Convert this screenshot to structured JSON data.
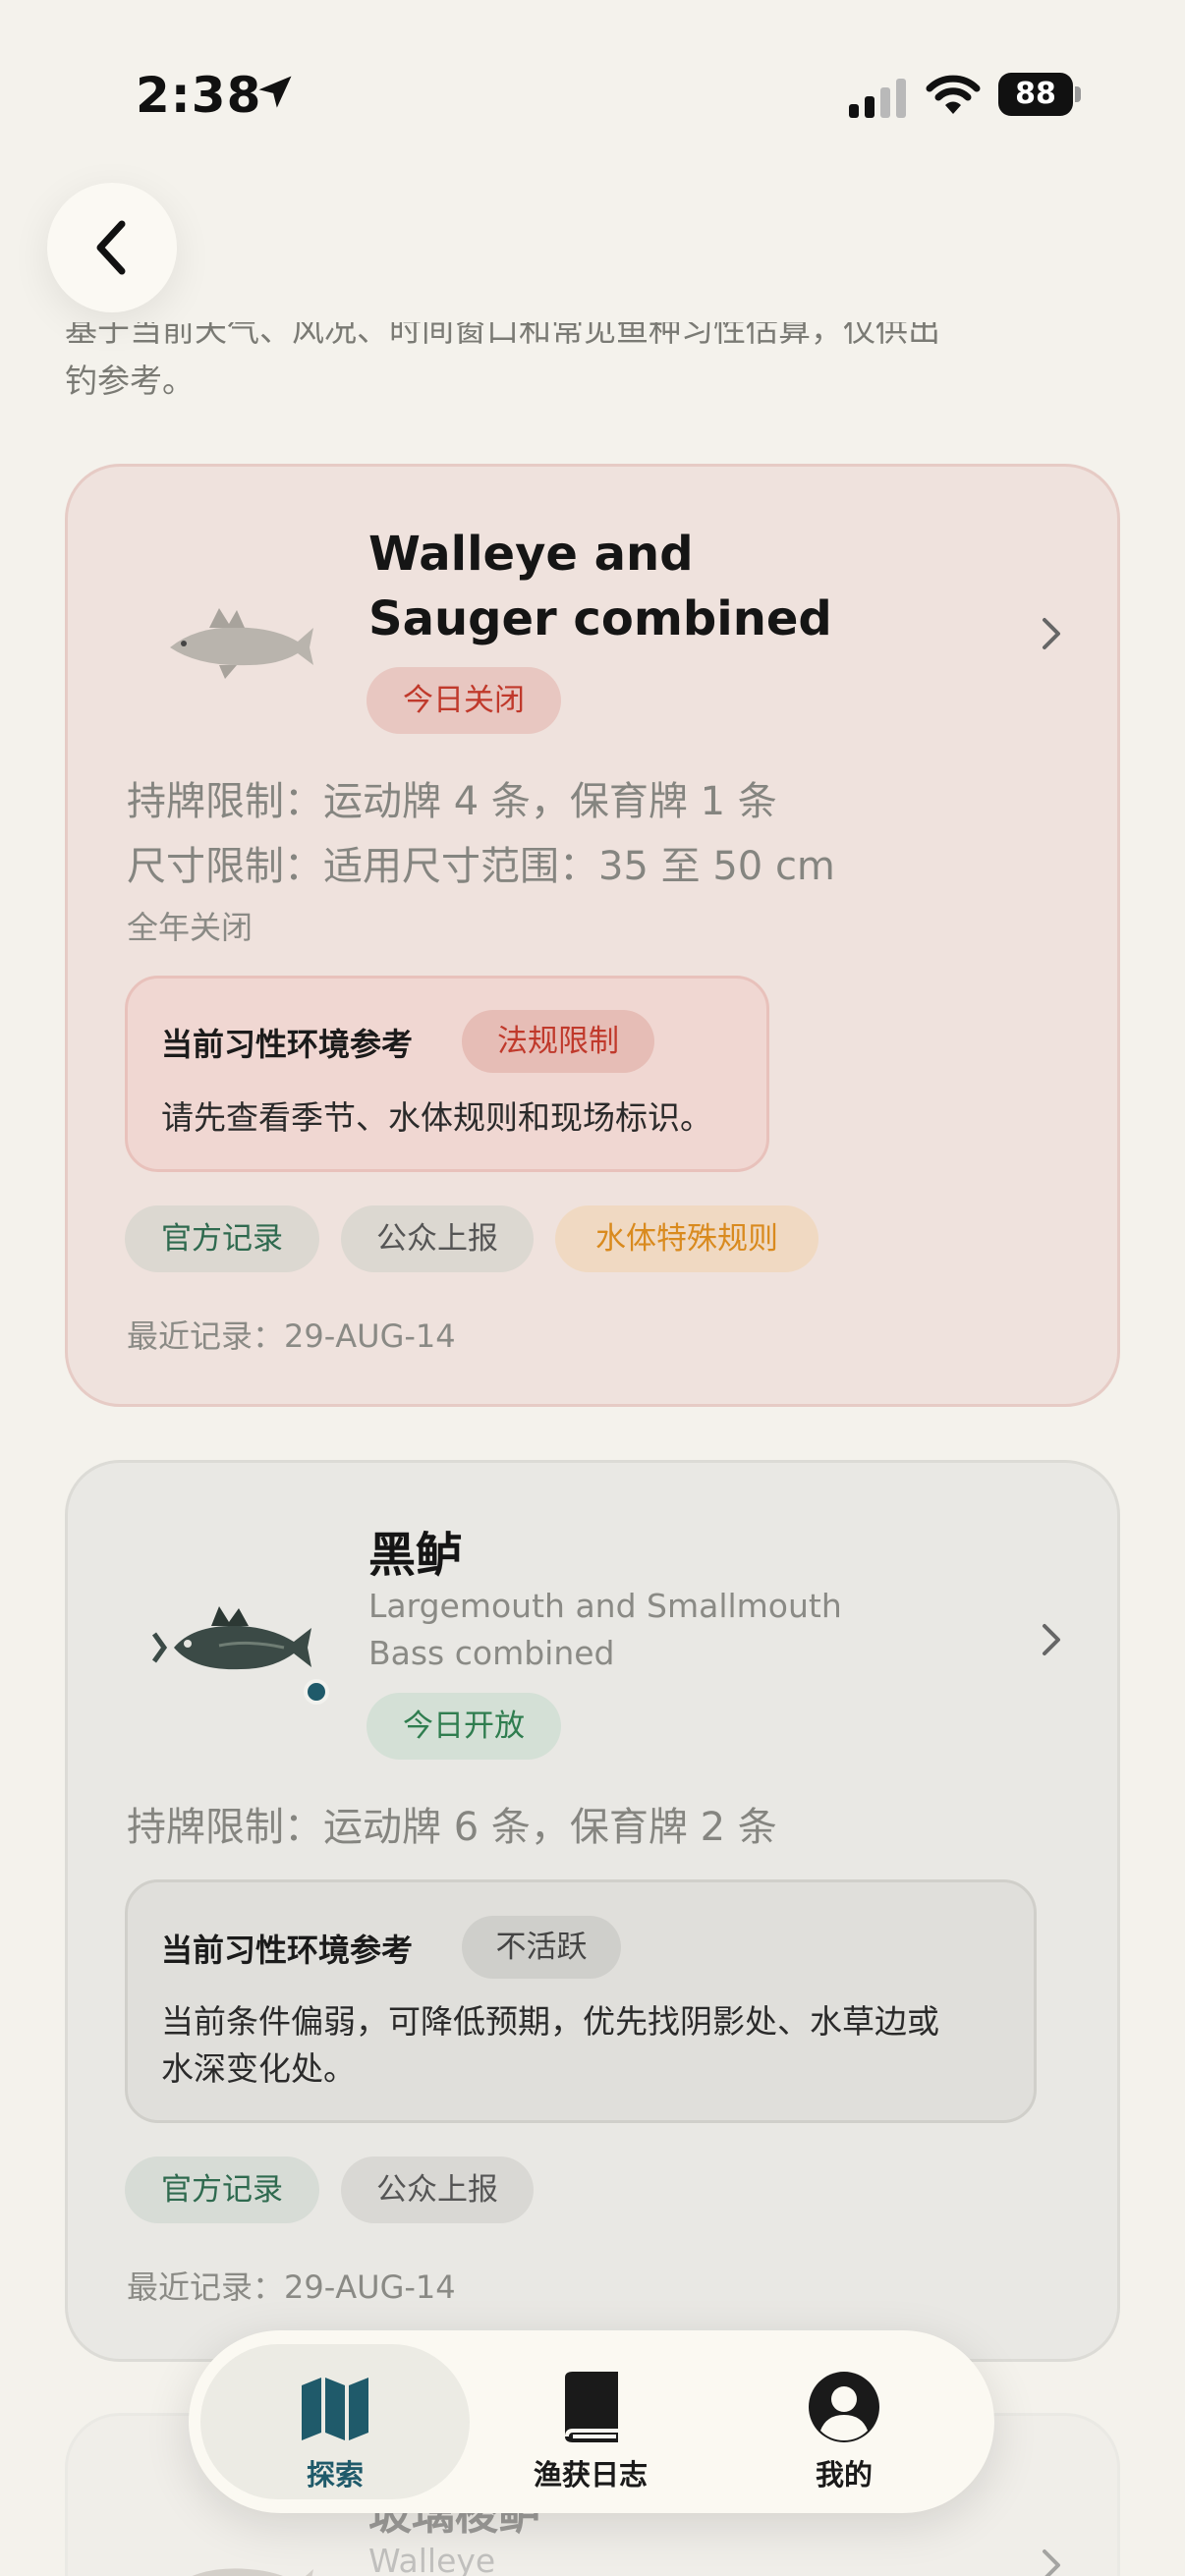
{
  "status_bar": {
    "time": "2:38",
    "battery": "88"
  },
  "intro": {
    "line1": "基于当前天气、风况、时间窗口和常见鱼种习性估算，仅供出",
    "line2": "钓参考。"
  },
  "cards": [
    {
      "name_line1": "Walleye and",
      "name_line2": "Sauger combined",
      "status": "今日关闭",
      "license_limit": "持牌限制：运动牌 4 条，保育牌 1 条",
      "size_limit": "尺寸限制：适用尺寸范围：35 至 50 cm",
      "season_note": "全年关闭",
      "habit_title": "当前习性环境参考",
      "habit_badge": "法规限制",
      "habit_desc": "请先查看季节、水体规则和现场标识。",
      "tags": [
        "官方记录",
        "公众上报",
        "水体特殊规则"
      ],
      "last_record": "最近记录：29-AUG-14"
    },
    {
      "name": "黑鲈",
      "subtitle_line1": "Largemouth and Smallmouth",
      "subtitle_line2": "Bass combined",
      "status": "今日开放",
      "license_limit": "持牌限制：运动牌 6 条，保育牌 2 条",
      "habit_title": "当前习性环境参考",
      "habit_badge": "不活跃",
      "habit_desc_line1": "当前条件偏弱，可降低预期，优先找阴影处、水草边或",
      "habit_desc_line2": "水深变化处。",
      "tags": [
        "官方记录",
        "公众上报"
      ],
      "last_record": "最近记录：29-AUG-14"
    },
    {
      "name": "玻璃梭鲈",
      "subtitle": "Walleye"
    }
  ],
  "tab_bar": {
    "tabs": [
      {
        "label": "探索",
        "icon": "map-icon",
        "active": true
      },
      {
        "label": "渔获日志",
        "icon": "book-icon",
        "active": false
      },
      {
        "label": "我的",
        "icon": "person-icon",
        "active": false
      }
    ]
  },
  "colors": {
    "background": "#f4f2ec",
    "closed_card": "#efe2dd",
    "closed_badge_text": "#c0392b",
    "open_badge_text": "#2f7d4f",
    "special_rule_text": "#d98a1e",
    "accent": "#1f5a6a"
  }
}
